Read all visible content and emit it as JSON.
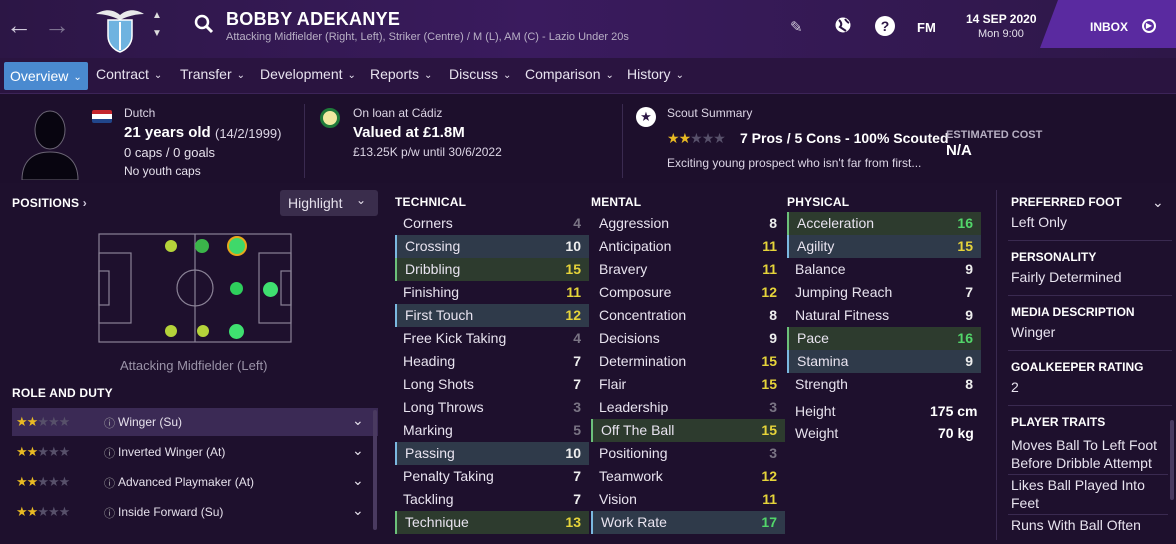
{
  "header": {
    "player_name": "BOBBY ADEKANYE",
    "subtitle": "Attacking Midfielder (Right, Left), Striker (Centre) / M (L), AM (C) - Lazio Under 20s",
    "club_crest_text": "S.S. LAZIO",
    "date": "14 SEP 2020",
    "time": "Mon 9:00",
    "fm_label": "FM",
    "inbox_label": "INBOX"
  },
  "tabs": [
    {
      "label": "Overview"
    },
    {
      "label": "Contract"
    },
    {
      "label": "Transfer"
    },
    {
      "label": "Development"
    },
    {
      "label": "Reports"
    },
    {
      "label": "Discuss"
    },
    {
      "label": "Comparison"
    },
    {
      "label": "History"
    }
  ],
  "info": {
    "nationality": "Dutch",
    "age": "21 years old",
    "dob": "(14/2/1999)",
    "caps": "0 caps / 0 goals",
    "youth_caps": "No youth caps",
    "loan": "On loan at Cádiz",
    "value": "Valued at £1.8M",
    "wage": "£13.25K p/w until 30/6/2022",
    "scout_label": "Scout Summary",
    "scout_stars": 2,
    "scout_summary": "7 Pros / 5 Cons - 100% Scouted",
    "scout_text": "Exciting young prospect who isn't far from first...",
    "est_cost_label": "ESTIMATED COST",
    "est_cost_value": "N/A"
  },
  "positions": {
    "title": "POSITIONS",
    "highlight_label": "Highlight",
    "selected_position": "Attacking Midfielder (Left)"
  },
  "roles": {
    "title": "ROLE AND DUTY",
    "items": [
      {
        "stars": 2,
        "label": "Winger (Su)"
      },
      {
        "stars": 2,
        "label": "Inverted Winger (At)"
      },
      {
        "stars": 2,
        "label": "Advanced Playmaker (At)"
      },
      {
        "stars": 2,
        "label": "Inside Forward (Su)"
      }
    ]
  },
  "technical": {
    "title": "TECHNICAL",
    "attrs": [
      {
        "name": "Corners",
        "value": "4",
        "hl": ""
      },
      {
        "name": "Crossing",
        "value": "10",
        "hl": "b"
      },
      {
        "name": "Dribbling",
        "value": "15",
        "hl": "g"
      },
      {
        "name": "Finishing",
        "value": "11",
        "hl": ""
      },
      {
        "name": "First Touch",
        "value": "12",
        "hl": "b"
      },
      {
        "name": "Free Kick Taking",
        "value": "4",
        "hl": ""
      },
      {
        "name": "Heading",
        "value": "7",
        "hl": ""
      },
      {
        "name": "Long Shots",
        "value": "7",
        "hl": ""
      },
      {
        "name": "Long Throws",
        "value": "3",
        "hl": ""
      },
      {
        "name": "Marking",
        "value": "5",
        "hl": ""
      },
      {
        "name": "Passing",
        "value": "10",
        "hl": "b"
      },
      {
        "name": "Penalty Taking",
        "value": "7",
        "hl": ""
      },
      {
        "name": "Tackling",
        "value": "7",
        "hl": ""
      },
      {
        "name": "Technique",
        "value": "13",
        "hl": "g"
      }
    ]
  },
  "mental": {
    "title": "MENTAL",
    "attrs": [
      {
        "name": "Aggression",
        "value": "8",
        "hl": ""
      },
      {
        "name": "Anticipation",
        "value": "11",
        "hl": ""
      },
      {
        "name": "Bravery",
        "value": "11",
        "hl": ""
      },
      {
        "name": "Composure",
        "value": "12",
        "hl": ""
      },
      {
        "name": "Concentration",
        "value": "8",
        "hl": ""
      },
      {
        "name": "Decisions",
        "value": "9",
        "hl": ""
      },
      {
        "name": "Determination",
        "value": "15",
        "hl": ""
      },
      {
        "name": "Flair",
        "value": "15",
        "hl": ""
      },
      {
        "name": "Leadership",
        "value": "3",
        "hl": ""
      },
      {
        "name": "Off The Ball",
        "value": "15",
        "hl": "g"
      },
      {
        "name": "Positioning",
        "value": "3",
        "hl": ""
      },
      {
        "name": "Teamwork",
        "value": "12",
        "hl": ""
      },
      {
        "name": "Vision",
        "value": "11",
        "hl": ""
      },
      {
        "name": "Work Rate",
        "value": "17",
        "hl": "b"
      }
    ]
  },
  "physical": {
    "title": "PHYSICAL",
    "attrs": [
      {
        "name": "Acceleration",
        "value": "16",
        "hl": "g"
      },
      {
        "name": "Agility",
        "value": "15",
        "hl": "b"
      },
      {
        "name": "Balance",
        "value": "9",
        "hl": ""
      },
      {
        "name": "Jumping Reach",
        "value": "7",
        "hl": ""
      },
      {
        "name": "Natural Fitness",
        "value": "9",
        "hl": ""
      },
      {
        "name": "Pace",
        "value": "16",
        "hl": "g"
      },
      {
        "name": "Stamina",
        "value": "9",
        "hl": "b"
      },
      {
        "name": "Strength",
        "value": "8",
        "hl": ""
      }
    ],
    "height_label": "Height",
    "height": "175 cm",
    "weight_label": "Weight",
    "weight": "70 kg"
  },
  "profile": {
    "pref_foot_label": "PREFERRED FOOT",
    "pref_foot": "Left Only",
    "personality_label": "PERSONALITY",
    "personality": "Fairly Determined",
    "media_label": "MEDIA DESCRIPTION",
    "media": "Winger",
    "gk_label": "GOALKEEPER RATING",
    "gk": "2",
    "traits_label": "PLAYER TRAITS",
    "traits": [
      "Moves Ball To Left Foot Before Dribble Attempt",
      "Likes Ball Played Into Feet",
      "Runs With Ball Often"
    ]
  }
}
